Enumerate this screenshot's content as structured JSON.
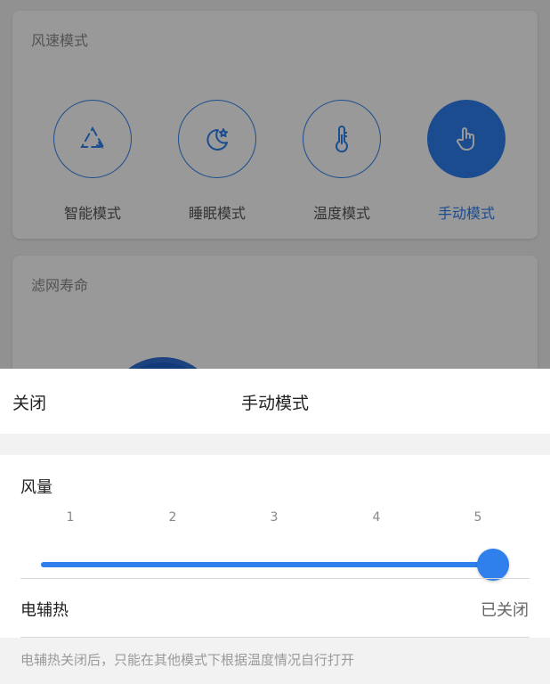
{
  "background": {
    "mode_card": {
      "title": "风速模式",
      "modes": [
        {
          "label": "智能模式",
          "icon": "smart-cycle-icon",
          "active": false
        },
        {
          "label": "睡眠模式",
          "icon": "moon-star-icon",
          "active": false
        },
        {
          "label": "温度模式",
          "icon": "thermometer-icon",
          "active": false
        },
        {
          "label": "手动模式",
          "icon": "hand-pointer-icon",
          "active": true
        }
      ]
    },
    "filter_card": {
      "title": "滤网寿命"
    }
  },
  "sheet": {
    "close_label": "关闭",
    "title": "手动模式",
    "wind": {
      "label": "风量",
      "levels": [
        "1",
        "2",
        "3",
        "4",
        "5"
      ],
      "value": 5,
      "min": 1,
      "max": 5
    },
    "heater": {
      "label": "电辅热",
      "status": "已关闭"
    },
    "note": "电辅热关闭后，只能在其他模式下根据温度情况自行打开"
  },
  "colors": {
    "accent": "#2f80ed",
    "overlay": "rgba(0,0,0,0.40)"
  }
}
